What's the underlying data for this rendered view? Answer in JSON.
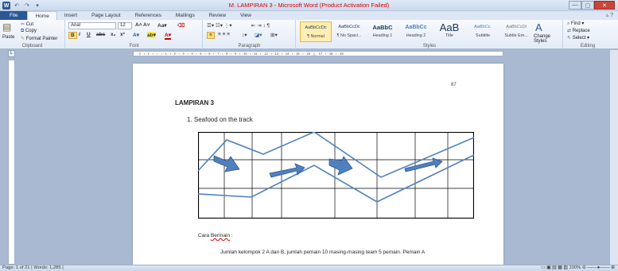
{
  "window": {
    "title": "M. LAMPIRAN 3 - Microsoft Word (Product Activation Failed)",
    "controls": [
      "—",
      "▢",
      "✕"
    ]
  },
  "qat": {
    "logo": "W",
    "undo": "↶",
    "redo": "↷",
    "more": "▾"
  },
  "tabs": [
    "File",
    "Home",
    "Insert",
    "Page Layout",
    "References",
    "Mailings",
    "Review",
    "View"
  ],
  "ribbon": {
    "clipboard": {
      "label": "Clipboard",
      "paste": "Paste",
      "cut": "Cut",
      "copy": "Copy",
      "format_painter": "Format Painter"
    },
    "font": {
      "label": "Font",
      "family": "Arial",
      "size": "12"
    },
    "paragraph": {
      "label": "Paragraph"
    },
    "styles": {
      "label": "Styles",
      "items": [
        {
          "preview": "AaBbCcDc",
          "name": "¶ Normal"
        },
        {
          "preview": "AaBbCcDc",
          "name": "¶ No Spaci..."
        },
        {
          "preview": "AaBbC",
          "name": "Heading 1"
        },
        {
          "preview": "AaBbCc",
          "name": "Heading 2"
        },
        {
          "preview": "AaB",
          "name": "Title"
        },
        {
          "preview": "AaBbCc.",
          "name": "Subtitle"
        },
        {
          "preview": "AaBbCcDi",
          "name": "Subtle Em..."
        }
      ],
      "change_styles": "Change Styles"
    },
    "editing": {
      "label": "Editing",
      "find": "Find",
      "replace": "Replace",
      "select": "Select"
    }
  },
  "ruler": {
    "ticks": "· 2 · ı · 1 · ı · ⌂ · ı · 1 · ı · 2 · ı · 3 · ı · 4 · ı · 5 · ı · 6 · ı · 7 · ı · 8 · ı · 9 · ı · 10 · ı · 11 · ı · 12 · ı · 13 · ı · 14 · ı · 15 · ı · 16 · △ · 17 · ı · 18 · ı · 19"
  },
  "document": {
    "page_number": "87",
    "heading": "LAMPIRAN 3",
    "item1": "1.   Seafood on the track",
    "cara_prefix": "Cara ",
    "cara_word": "Bermain",
    "cara_suffix": " :",
    "body_line": "Jumlah kelompok 2 A dan B, jumlah pemain 10 masing-masing team 5 pemain. Pemain A"
  },
  "status": {
    "left": "Page: 1 of 21  |  Words: 1,285  |",
    "zoom": "100%"
  }
}
